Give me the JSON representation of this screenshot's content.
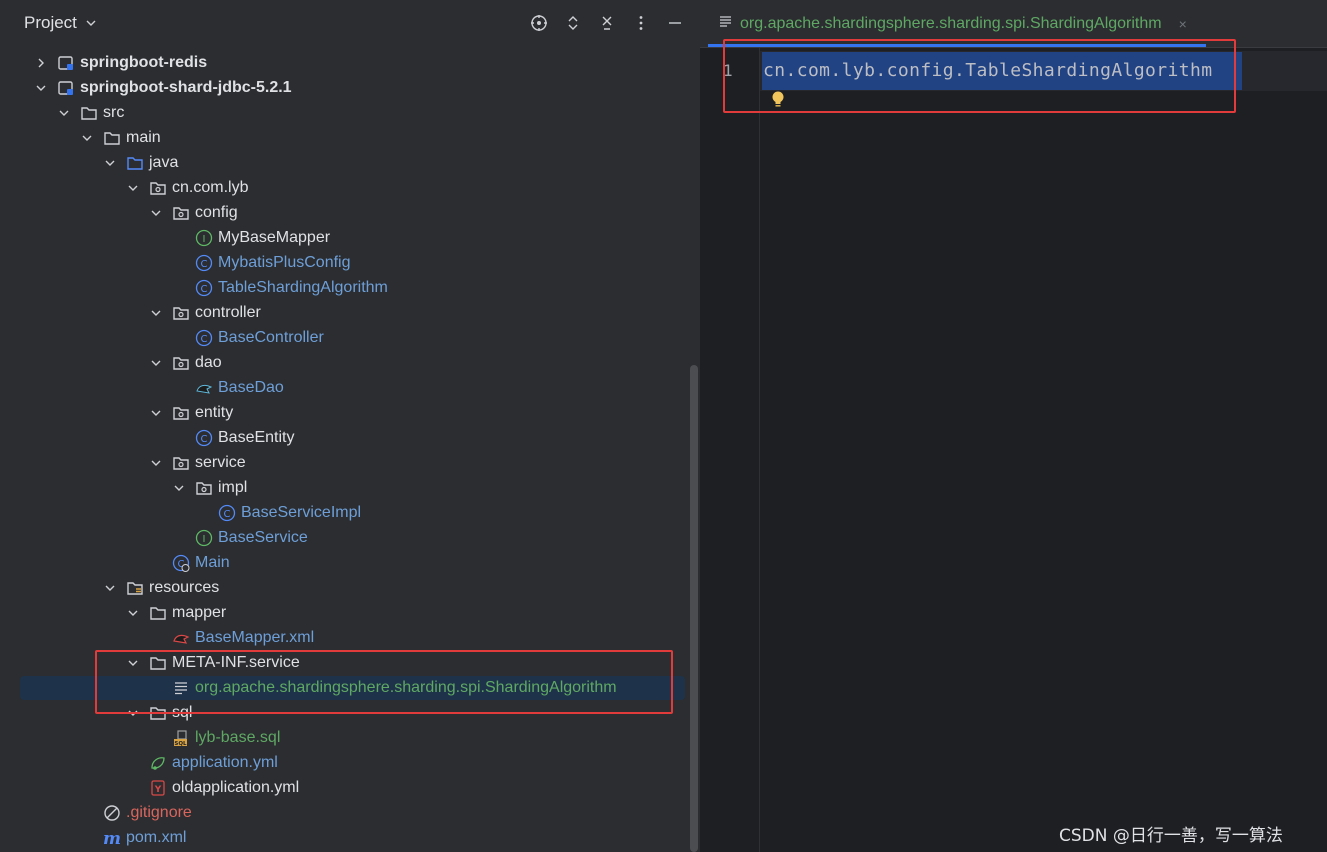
{
  "panel": {
    "title": "Project",
    "actions": [
      "locate-icon",
      "expand-collapse-icon",
      "close-all-icon",
      "more-icon",
      "minimize-icon"
    ]
  },
  "tree": [
    {
      "label": "springboot-redis",
      "indent": 0,
      "expanded": false,
      "icon": "module-icon",
      "color": "white",
      "bold": true
    },
    {
      "label": "springboot-shard-jdbc-5.2.1",
      "indent": 0,
      "expanded": true,
      "icon": "module-icon",
      "color": "white",
      "bold": true
    },
    {
      "label": "src",
      "indent": 1,
      "expanded": true,
      "icon": "folder-icon",
      "color": "white"
    },
    {
      "label": "main",
      "indent": 2,
      "expanded": true,
      "icon": "folder-icon",
      "color": "white"
    },
    {
      "label": "java",
      "indent": 3,
      "expanded": true,
      "icon": "source-folder-icon",
      "color": "white"
    },
    {
      "label": "cn.com.lyb",
      "indent": 4,
      "expanded": true,
      "icon": "package-icon",
      "color": "white"
    },
    {
      "label": "config",
      "indent": 5,
      "expanded": true,
      "icon": "package-icon",
      "color": "white"
    },
    {
      "label": "MyBaseMapper",
      "indent": 6,
      "icon": "interface-icon",
      "color": "white"
    },
    {
      "label": "MybatisPlusConfig",
      "indent": 6,
      "icon": "class-icon",
      "color": "blue"
    },
    {
      "label": "TableShardingAlgorithm",
      "indent": 6,
      "icon": "class-icon",
      "color": "blue"
    },
    {
      "label": "controller",
      "indent": 5,
      "expanded": true,
      "icon": "package-icon",
      "color": "white"
    },
    {
      "label": "BaseController",
      "indent": 6,
      "icon": "class-icon",
      "color": "blue"
    },
    {
      "label": "dao",
      "indent": 5,
      "expanded": true,
      "icon": "package-icon",
      "color": "white"
    },
    {
      "label": "BaseDao",
      "indent": 6,
      "icon": "mybatis-mapper-icon",
      "color": "blue"
    },
    {
      "label": "entity",
      "indent": 5,
      "expanded": true,
      "icon": "package-icon",
      "color": "white"
    },
    {
      "label": "BaseEntity",
      "indent": 6,
      "icon": "class-icon",
      "color": "white"
    },
    {
      "label": "service",
      "indent": 5,
      "expanded": true,
      "icon": "package-icon",
      "color": "white"
    },
    {
      "label": "impl",
      "indent": 6,
      "expanded": true,
      "icon": "package-icon",
      "color": "white"
    },
    {
      "label": "BaseServiceImpl",
      "indent": 7,
      "icon": "class-icon",
      "color": "blue"
    },
    {
      "label": "BaseService",
      "indent": 6,
      "icon": "interface-icon",
      "color": "blue"
    },
    {
      "label": "Main",
      "indent": 5,
      "icon": "main-class-icon",
      "color": "blue"
    },
    {
      "label": "resources",
      "indent": 3,
      "expanded": true,
      "icon": "resources-folder-icon",
      "color": "white"
    },
    {
      "label": "mapper",
      "indent": 4,
      "expanded": true,
      "icon": "folder-icon",
      "color": "white"
    },
    {
      "label": "BaseMapper.xml",
      "indent": 5,
      "icon": "mybatis-xml-icon",
      "color": "blue"
    },
    {
      "label": "META-INF.service",
      "indent": 4,
      "expanded": true,
      "icon": "folder-icon",
      "color": "white"
    },
    {
      "label": "org.apache.shardingsphere.sharding.spi.ShardingAlgorithm",
      "indent": 5,
      "icon": "text-file-icon",
      "color": "green",
      "selected": true
    },
    {
      "label": "sql",
      "indent": 4,
      "expanded": true,
      "icon": "folder-icon",
      "color": "white"
    },
    {
      "label": "lyb-base.sql",
      "indent": 5,
      "icon": "sql-file-icon",
      "color": "green"
    },
    {
      "label": "application.yml",
      "indent": 4,
      "icon": "spring-yml-icon",
      "color": "blue"
    },
    {
      "label": "oldapplication.yml",
      "indent": 4,
      "icon": "yaml-icon",
      "color": "white"
    },
    {
      "label": ".gitignore",
      "indent": 2,
      "icon": "ignore-icon",
      "color": "red"
    },
    {
      "label": "pom.xml",
      "indent": 2,
      "icon": "maven-icon",
      "color": "blue"
    }
  ],
  "editor": {
    "tab_label": "org.apache.shardingsphere.sharding.spi.ShardingAlgorithm",
    "tab_close": "×",
    "line_number": "1",
    "code": "cn.com.lyb.config.TableShardingAlgorithm"
  },
  "watermark": "CSDN @日行一善，写一算法",
  "colors": {
    "highlight_box": "#e23b3b",
    "selection": "#214283",
    "tree_selected": "#1e3349"
  }
}
